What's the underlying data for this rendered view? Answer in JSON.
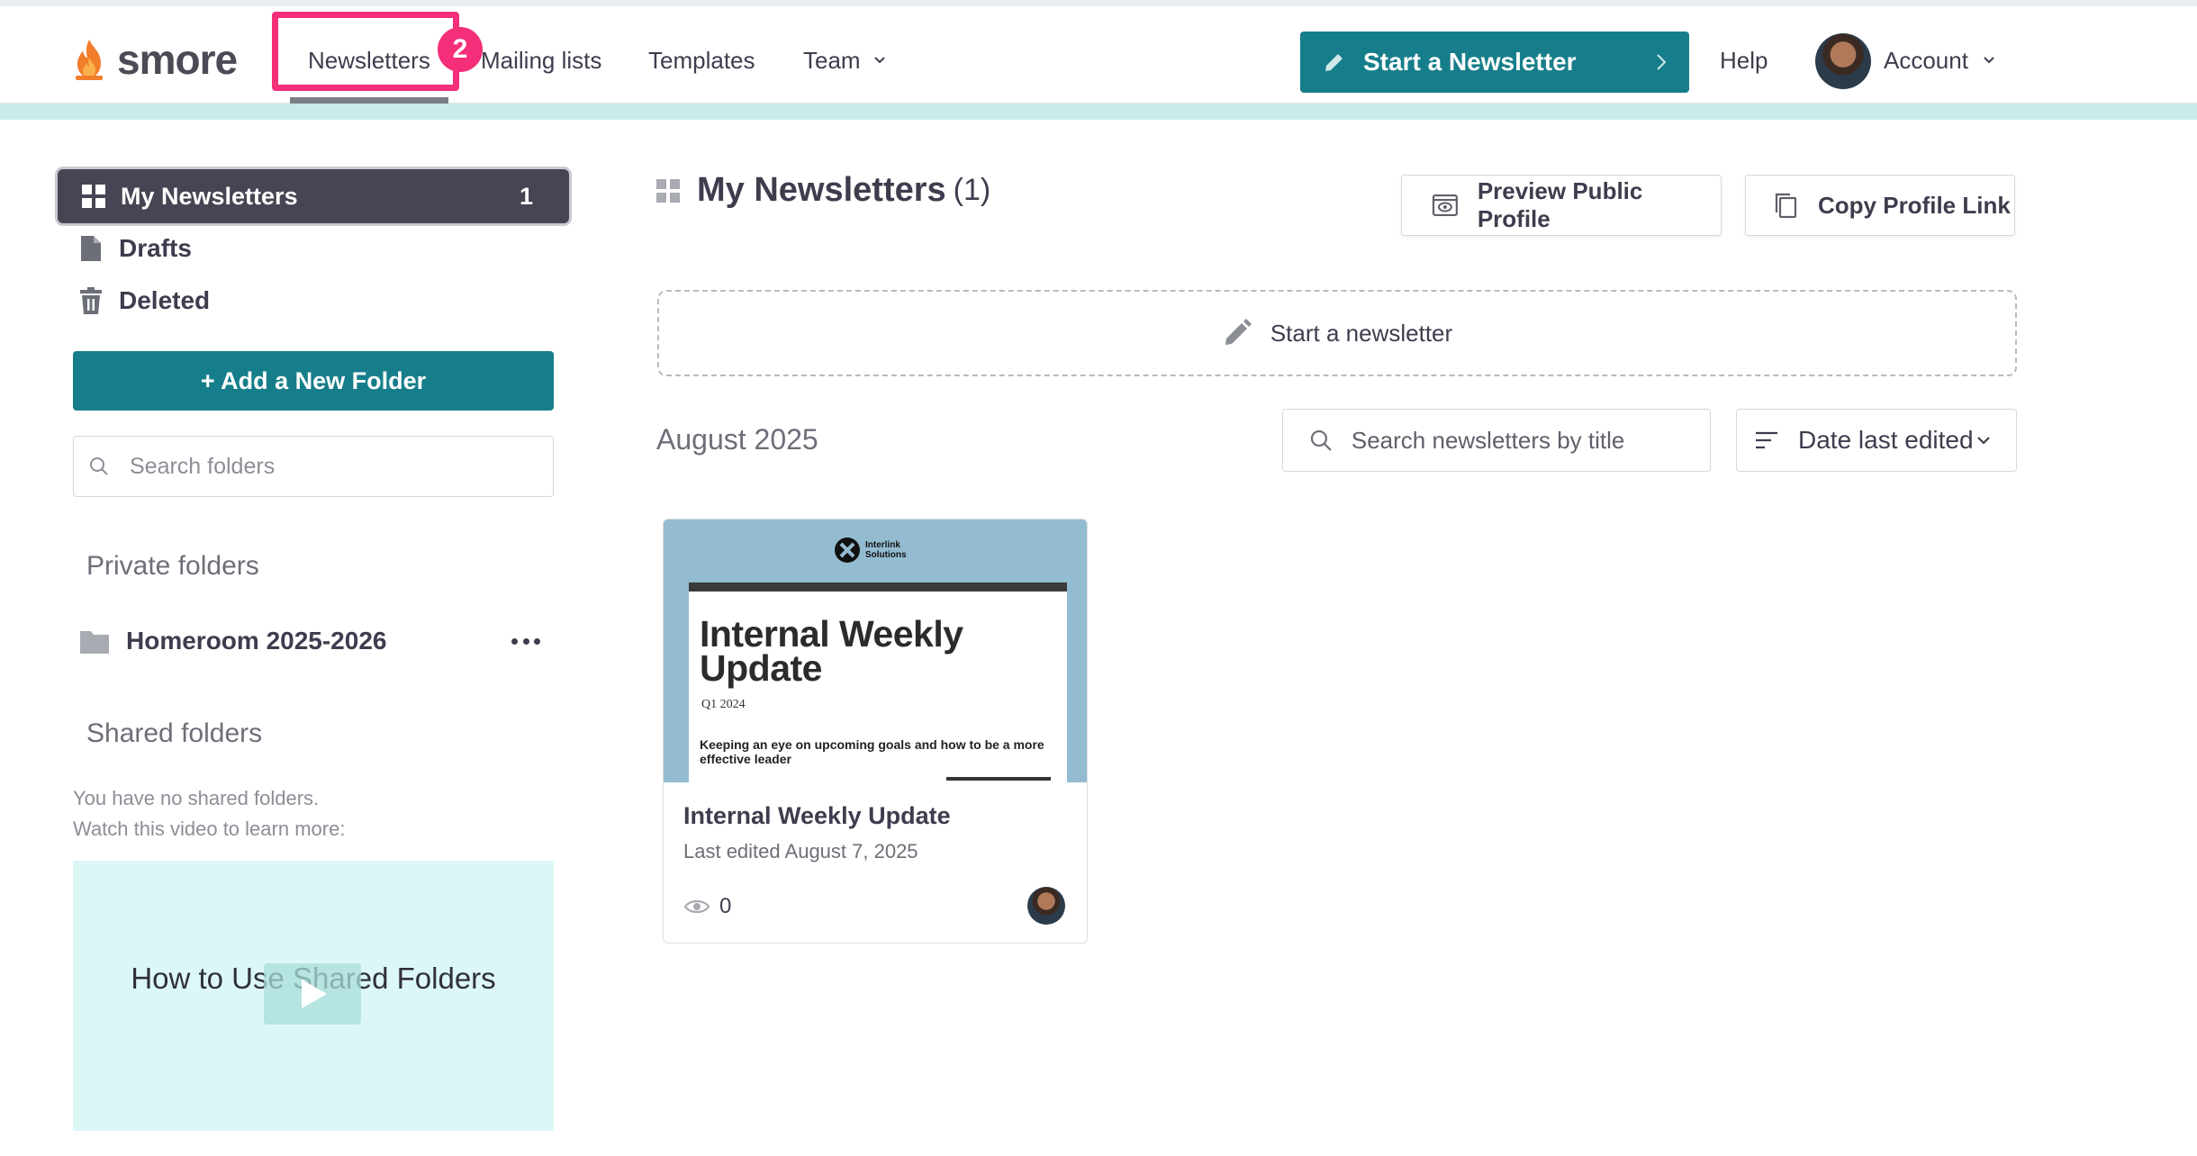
{
  "app": {
    "name": "smore"
  },
  "nav": {
    "newsletters": "Newsletters",
    "mailing_lists": "Mailing lists",
    "templates": "Templates",
    "team": "Team",
    "help": "Help",
    "account": "Account",
    "start_newsletter": "Start a Newsletter"
  },
  "annotation": {
    "step": "2",
    "color": "#f42e79"
  },
  "sidebar": {
    "my_newsletters": {
      "label": "My Newsletters",
      "count": "1"
    },
    "drafts": "Drafts",
    "deleted": "Deleted",
    "add_folder": "+ Add a New Folder",
    "search_placeholder": "Search folders",
    "private_title": "Private folders",
    "private_folders": [
      {
        "name": "Homeroom 2025-2026"
      }
    ],
    "shared_title": "Shared folders",
    "shared_note_1": "You have no shared folders.",
    "shared_note_2": "Watch this video to learn more:",
    "video_title": "How to Use Shared Folders"
  },
  "main": {
    "title": "My Newsletters",
    "count": "(1)",
    "preview_profile": "Preview Public Profile",
    "copy_profile_link": "Copy Profile Link",
    "start_box": "Start a newsletter",
    "month": "August 2025",
    "search_placeholder": "Search newsletters by title",
    "sort_value": "Date last edited"
  },
  "cards": [
    {
      "title": "Internal Weekly Update",
      "edited": "Last edited August 7, 2025",
      "views": "0",
      "thumbnail": {
        "brand": "Interlink Solutions",
        "heading": "Internal Weekly Update",
        "date": "Q1 2024",
        "subtitle": "Keeping an eye on upcoming goals and how to be a more effective leader"
      }
    }
  ],
  "colors": {
    "accent": "#167e8a",
    "dark": "#454554",
    "strip": "#c9ece9"
  }
}
